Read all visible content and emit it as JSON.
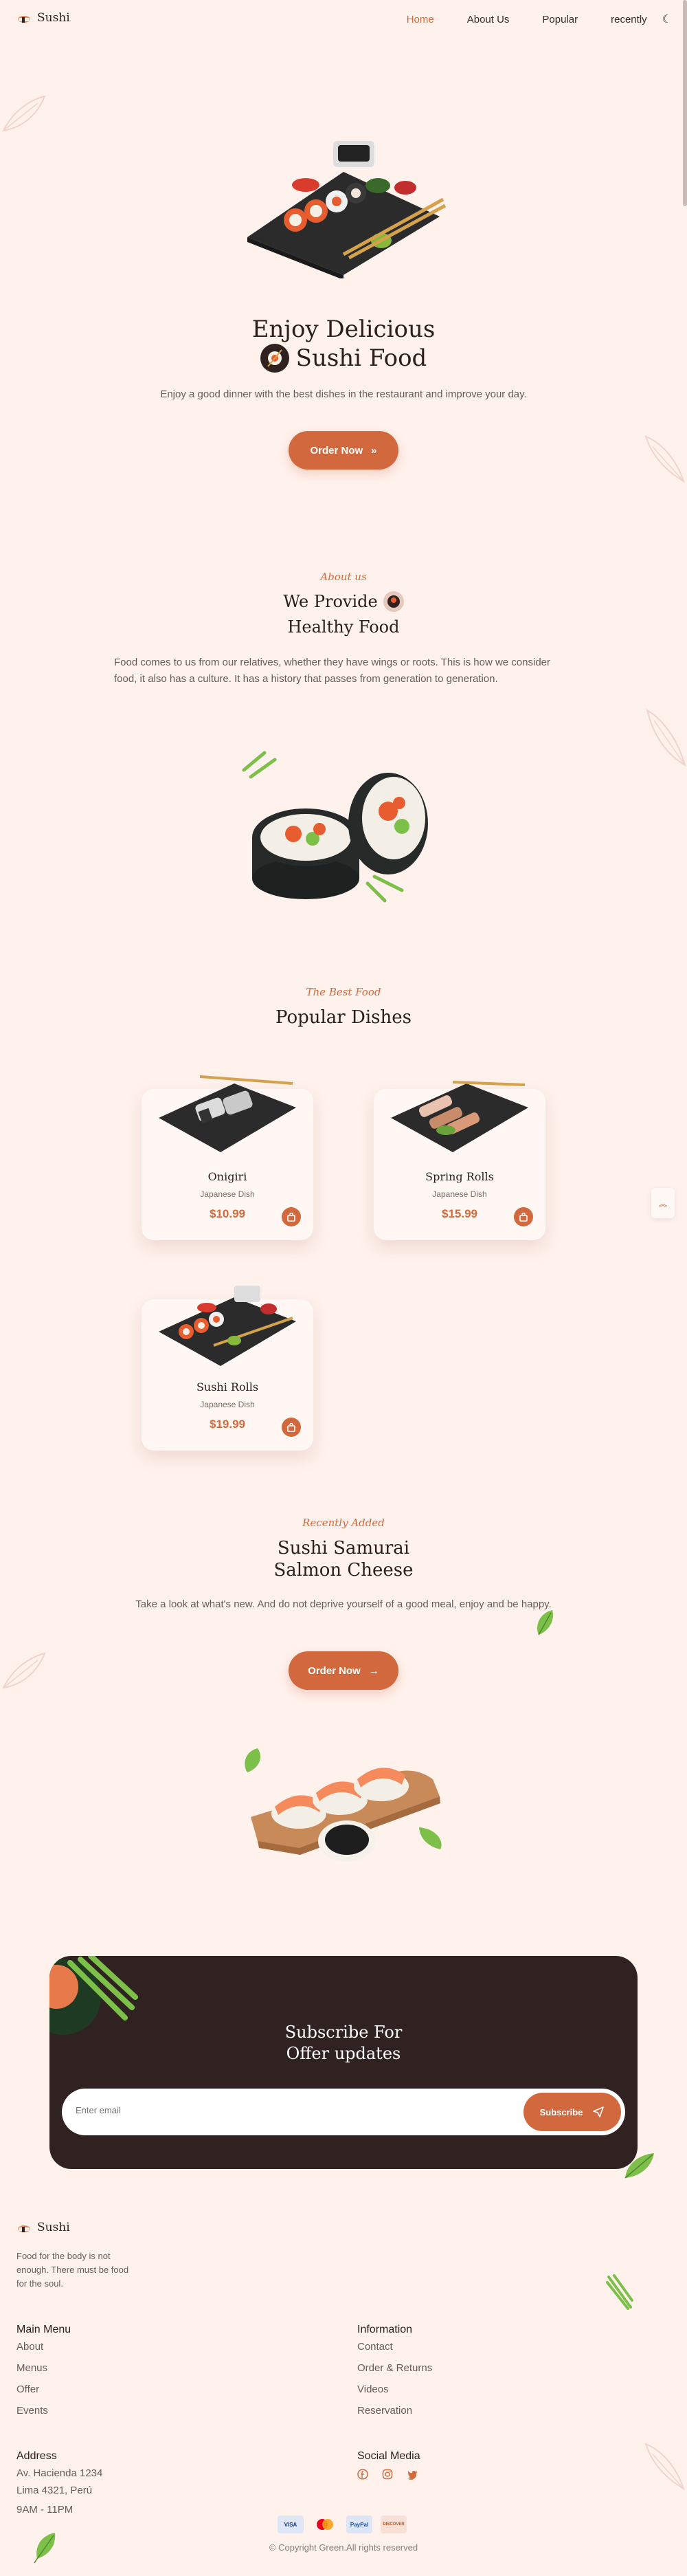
{
  "header": {
    "brand": "Sushi",
    "nav": [
      "Home",
      "About Us",
      "Popular",
      "recently"
    ],
    "active": "Home"
  },
  "hero": {
    "title_line1": "Enjoy Delicious",
    "title_line2": "Sushi Food",
    "description": "Enjoy a good dinner with the best dishes in the restaurant and improve your day.",
    "cta": "Order Now"
  },
  "about": {
    "subtitle": "About us",
    "title_line1": "We Provide",
    "title_line2": "Healthy Food",
    "description": "Food comes to us from our relatives, whether they have wings or roots. This is how we consider food, it also has a culture. It has a history that passes from generation to generation."
  },
  "popular": {
    "subtitle": "The Best Food",
    "title": "Popular Dishes",
    "items": [
      {
        "name": "Onigiri",
        "desc": "Japanese Dish",
        "price": "$10.99"
      },
      {
        "name": "Spring Rolls",
        "desc": "Japanese Dish",
        "price": "$15.99"
      },
      {
        "name": "Sushi Rolls",
        "desc": "Japanese Dish",
        "price": "$19.99"
      }
    ]
  },
  "recent": {
    "subtitle": "Recently Added",
    "title_line1": "Sushi Samurai",
    "title_line2": "Salmon Cheese",
    "description": "Take a look at what's new. And do not deprive yourself of a good meal, enjoy and be happy.",
    "cta": "Order Now"
  },
  "subscribe": {
    "title_line1": "Subscribe For",
    "title_line2": "Offer updates",
    "placeholder": "Enter email",
    "button": "Subscribe"
  },
  "footer": {
    "brand": "Sushi",
    "tagline_line1": "Food for the body is not",
    "tagline_line2": "enough. There must be food",
    "tagline_line3": "for the soul.",
    "main_menu": {
      "title": "Main Menu",
      "links": [
        "About",
        "Menus",
        "Offer",
        "Events"
      ]
    },
    "information": {
      "title": "Information",
      "links": [
        "Contact",
        "Order & Returns",
        "Videos",
        "Reservation"
      ]
    },
    "address": {
      "title": "Address",
      "line1": "Av. Hacienda 1234",
      "line2": "Lima 4321, Perú",
      "hours": "9AM - 11PM"
    },
    "social": {
      "title": "Social Media",
      "icons": [
        "facebook-icon",
        "instagram-icon",
        "twitter-icon"
      ]
    },
    "payments": [
      "VISA",
      "mastercard",
      "PayPal",
      "DISCOVER"
    ],
    "copyright": "© Copyright Green.All rights reserved"
  },
  "colors": {
    "accent": "#d2683d",
    "background": "#fff1ec",
    "dark": "#2f2220"
  }
}
